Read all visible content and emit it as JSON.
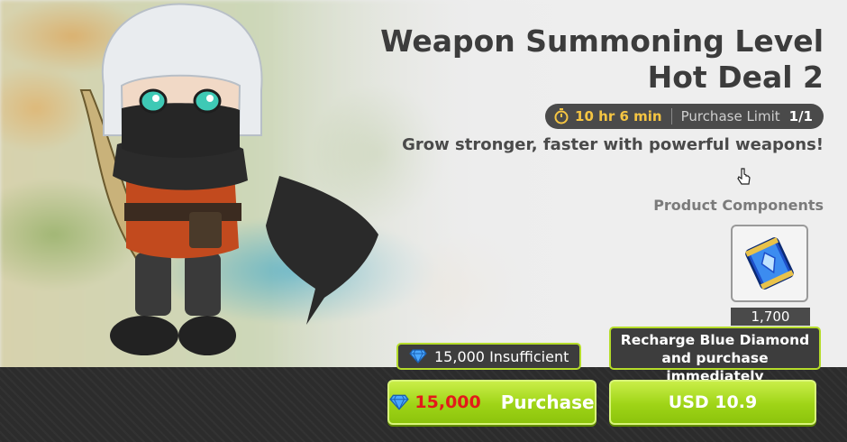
{
  "product": {
    "title_line1": "Weapon Summoning Level",
    "title_line2": "Hot Deal 2",
    "timer": "10 hr 6 min",
    "purchase_limit_label": "Purchase Limit",
    "purchase_limit_value": "1/1",
    "tagline": "Grow stronger, faster with powerful weapons!",
    "components_label": "Product Components"
  },
  "component": {
    "icon": "blue-diamond-ticket-icon",
    "count": "1,700"
  },
  "purchase": {
    "insufficient_text": "15,000 Insufficient",
    "price": "15,000",
    "button_label": "Purchase",
    "recharge_line1": "Recharge Blue Diamond",
    "recharge_line2": "and purchase immediately",
    "usd_button_label": "USD 10.9"
  },
  "colors": {
    "accent_green": "#9fd417",
    "price_red": "#e31a1a",
    "timer_gold": "#f5c542",
    "dark_panel": "#2c2c2c"
  }
}
